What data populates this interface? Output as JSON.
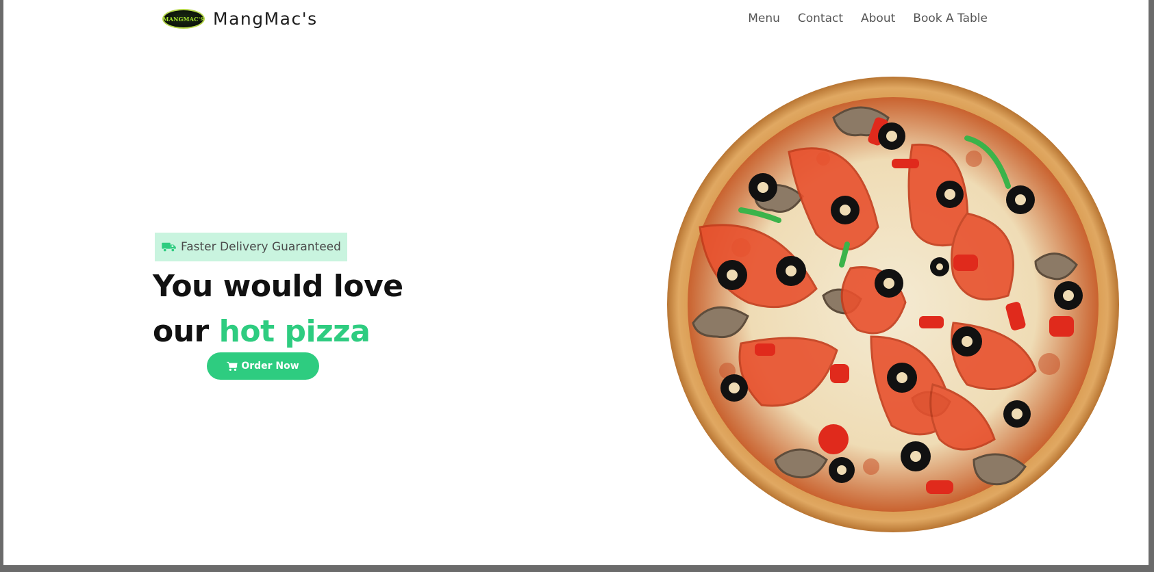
{
  "header": {
    "logo_text": "MANGMAC'S",
    "brand": "MangMac's",
    "nav": [
      "Menu",
      "Contact",
      "About",
      "Book A Table"
    ]
  },
  "hero": {
    "badge_text": "Faster Delivery Guaranteed",
    "headline_line1": "You would love",
    "headline_line2_prefix": "our",
    "headline_line2_accent": "hot pizza",
    "order_button": "Order Now"
  },
  "colors": {
    "accent": "#2ecc80",
    "badge_bg": "#c9f4df",
    "text_dark": "#111111",
    "nav_text": "#555555"
  },
  "icons": {
    "badge": "truck-icon",
    "button": "cart-icon"
  }
}
